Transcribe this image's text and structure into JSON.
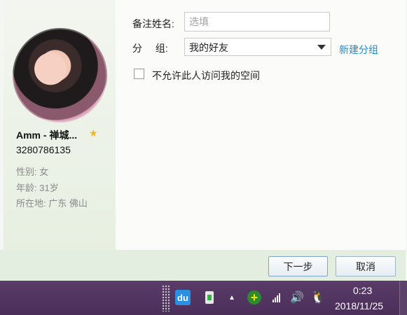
{
  "profile": {
    "name": "Amm - 禅城...",
    "qq": "3280786135",
    "gender_label": "性别:",
    "gender_value": "女",
    "age_label": "年龄:",
    "age_value": "31岁",
    "location_label": "所在地:",
    "location_value": "广东  佛山"
  },
  "form": {
    "remark_label": "备注姓名:",
    "remark_placeholder": "选填",
    "group_label": "分 组:",
    "group_value": "我的好友",
    "new_group_link": "新建分组",
    "privacy_label": "不允许此人访问我的空间"
  },
  "buttons": {
    "next": "下一步",
    "cancel": "取消"
  },
  "taskbar": {
    "du_icon_text": "du",
    "time": "0:23",
    "date": "2018/11/25"
  },
  "colors": {
    "link": "#1c8bd7",
    "star": "#f3b51c",
    "taskbar": "#4b2f59"
  }
}
